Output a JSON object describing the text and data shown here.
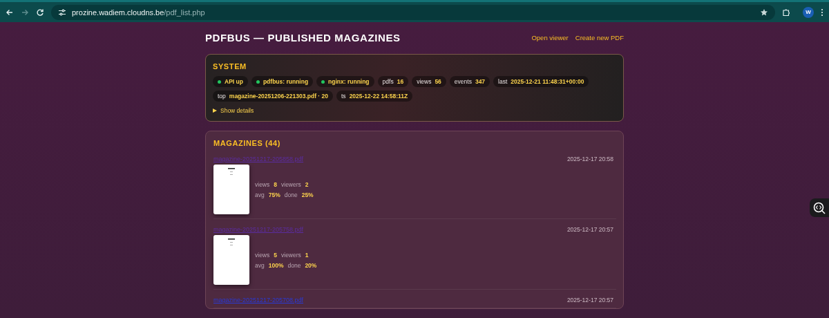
{
  "browser": {
    "url_host": "prozine.wadiem.cloudns.be",
    "url_path": "/pdf_list.php",
    "forward_disabled": true,
    "profile_initial": "W"
  },
  "header": {
    "title": "PDFBUS — PUBLISHED MAGAZINES",
    "actions": [
      "Open viewer",
      "Create new PDF"
    ]
  },
  "system": {
    "title": "SYSTEM",
    "chips": [
      {
        "kind": "status",
        "label": "API up",
        "color": "#22c55e"
      },
      {
        "kind": "status",
        "label": "pdfbus: running",
        "color": "#22c55e"
      },
      {
        "kind": "status",
        "label": "nginx: running",
        "color": "#22c55e"
      },
      {
        "kind": "stat",
        "label": "pdfs",
        "value": "16"
      },
      {
        "kind": "stat",
        "label": "views",
        "value": "56"
      },
      {
        "kind": "stat",
        "label": "events",
        "value": "347"
      },
      {
        "kind": "stat",
        "label": "last",
        "value": "2025-12-21 11:48:31+00:00"
      },
      {
        "kind": "stat",
        "label": "top",
        "value": "magazine-20251206-221303.pdf · 20"
      },
      {
        "kind": "stat",
        "label": "ts",
        "value": "2025-12-22 14:58:11Z"
      }
    ],
    "details": {
      "label": "Show details",
      "expanded": false
    }
  },
  "magazines": {
    "title": "MAGAZINES (44)",
    "items": [
      {
        "name": "magazine-20251217-205858.pdf",
        "visited": true,
        "date": "2025-12-17 20:58",
        "stats": [
          [
            {
              "label": "views",
              "value": "8"
            },
            {
              "label": "viewers",
              "value": "2"
            }
          ],
          [
            {
              "label": "avg",
              "value": "75%"
            },
            {
              "label": "done",
              "value": "25%"
            }
          ]
        ]
      },
      {
        "name": "magazine-20251217-205758.pdf",
        "visited": true,
        "date": "2025-12-17 20:57",
        "stats": [
          [
            {
              "label": "views",
              "value": "5"
            },
            {
              "label": "viewers",
              "value": "1"
            }
          ],
          [
            {
              "label": "avg",
              "value": "100%"
            },
            {
              "label": "done",
              "value": "20%"
            }
          ]
        ]
      },
      {
        "name": "magazine-20251217-205708.pdf",
        "visited": false,
        "date": "2025-12-17 20:57"
      }
    ]
  }
}
